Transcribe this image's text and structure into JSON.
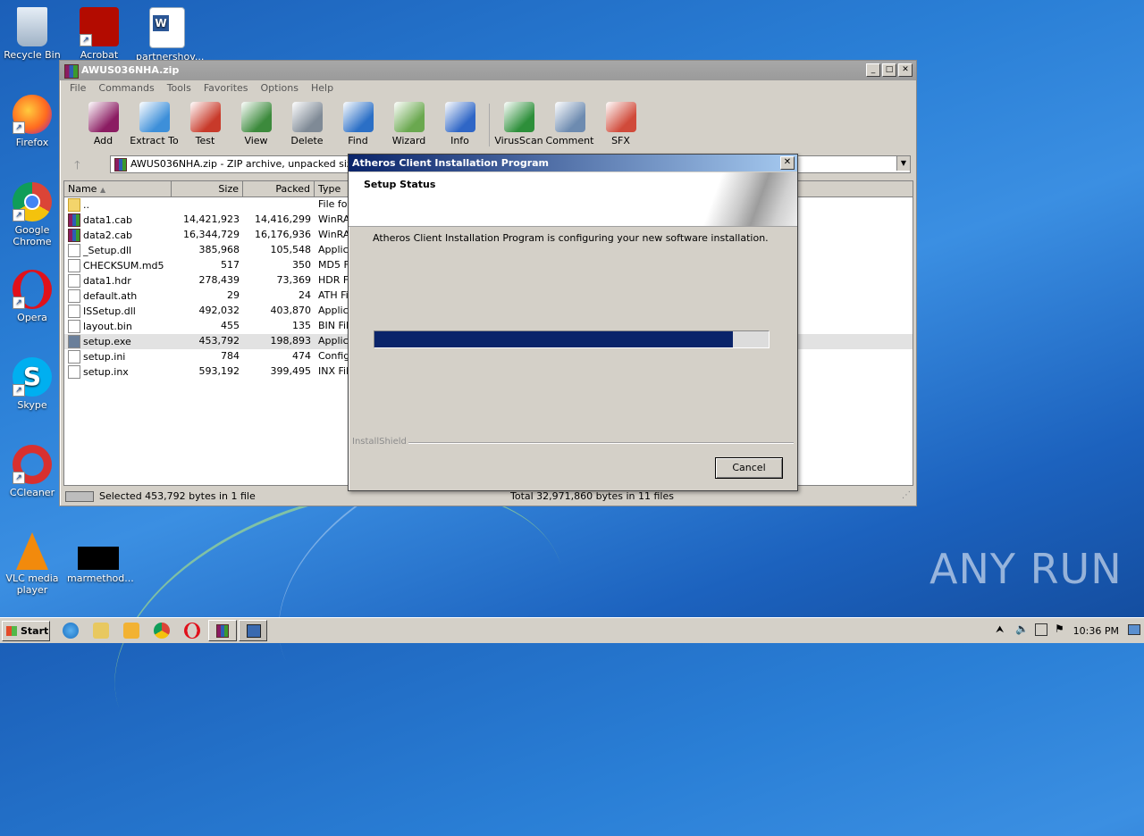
{
  "desktop": {
    "icons": [
      {
        "label": "Recycle Bin"
      },
      {
        "label": "Acrobat"
      },
      {
        "label": "partnershov..."
      },
      {
        "label": "Firefox"
      },
      {
        "label": "Google Chrome"
      },
      {
        "label": "Opera"
      },
      {
        "label": "Skype"
      },
      {
        "label": "CCleaner"
      },
      {
        "label": "VLC media player"
      },
      {
        "label": "marmethod..."
      }
    ],
    "watermark": "ANY RUN"
  },
  "winrar": {
    "title": "AWUS036NHA.zip",
    "menu": [
      "File",
      "Commands",
      "Tools",
      "Favorites",
      "Options",
      "Help"
    ],
    "toolbar": [
      {
        "label": "Add",
        "icon": "add-archive-icon",
        "color": "#8b1c62"
      },
      {
        "label": "Extract To",
        "icon": "extract-folder-icon",
        "color": "#3d8fd9"
      },
      {
        "label": "Test",
        "icon": "test-clipboard-icon",
        "color": "#c83a2a"
      },
      {
        "label": "View",
        "icon": "view-book-icon",
        "color": "#3c8a3c"
      },
      {
        "label": "Delete",
        "icon": "delete-trash-icon",
        "color": "#7f8a96"
      },
      {
        "label": "Find",
        "icon": "find-magnifier-icon",
        "color": "#2b6fc6"
      },
      {
        "label": "Wizard",
        "icon": "wizard-wand-icon",
        "color": "#6aa84f"
      },
      {
        "label": "Info",
        "icon": "info-icon",
        "color": "#2f66c6"
      },
      {
        "label": "VirusScan",
        "icon": "virusscan-bug-icon",
        "color": "#2d8f3a"
      },
      {
        "label": "Comment",
        "icon": "comment-icon",
        "color": "#6d8bb0"
      },
      {
        "label": "SFX",
        "icon": "sfx-books-icon",
        "color": "#d04a3a"
      }
    ],
    "address": "AWUS036NHA.zip - ZIP archive, unpacked size 32,",
    "columns": [
      "Name",
      "Size",
      "Packed",
      "Type"
    ],
    "files": [
      {
        "name": "..",
        "size": "",
        "packed": "",
        "type": "File fol",
        "kind": "folder"
      },
      {
        "name": "data1.cab",
        "size": "14,421,923",
        "packed": "14,416,299",
        "type": "WinRA",
        "kind": "rar"
      },
      {
        "name": "data2.cab",
        "size": "16,344,729",
        "packed": "16,176,936",
        "type": "WinRA",
        "kind": "rar"
      },
      {
        "name": "_Setup.dll",
        "size": "385,968",
        "packed": "105,548",
        "type": "Applica",
        "kind": "file"
      },
      {
        "name": "CHECKSUM.md5",
        "size": "517",
        "packed": "350",
        "type": "MD5 Fi",
        "kind": "file"
      },
      {
        "name": "data1.hdr",
        "size": "278,439",
        "packed": "73,369",
        "type": "HDR Fi",
        "kind": "file"
      },
      {
        "name": "default.ath",
        "size": "29",
        "packed": "24",
        "type": "ATH Fi",
        "kind": "file"
      },
      {
        "name": "ISSetup.dll",
        "size": "492,032",
        "packed": "403,870",
        "type": "Applica",
        "kind": "file"
      },
      {
        "name": "layout.bin",
        "size": "455",
        "packed": "135",
        "type": "BIN File",
        "kind": "file"
      },
      {
        "name": "setup.exe",
        "size": "453,792",
        "packed": "198,893",
        "type": "Applica",
        "kind": "exe",
        "selected": true
      },
      {
        "name": "setup.ini",
        "size": "784",
        "packed": "474",
        "type": "Config",
        "kind": "file"
      },
      {
        "name": "setup.inx",
        "size": "593,192",
        "packed": "399,495",
        "type": "INX File",
        "kind": "file"
      }
    ],
    "status_left": "Selected 453,792 bytes in 1 file",
    "status_right": "Total 32,971,860 bytes in 11 files"
  },
  "dialog": {
    "title": "Atheros Client Installation Program",
    "heading": "Setup Status",
    "message": "Atheros Client Installation Program is configuring your new software installation.",
    "progress": 0.91,
    "brand": "InstallShield",
    "cancel_label": "Cancel",
    "close_label": "✕"
  },
  "taskbar": {
    "start_label": "Start",
    "clock": "10:36 PM"
  }
}
